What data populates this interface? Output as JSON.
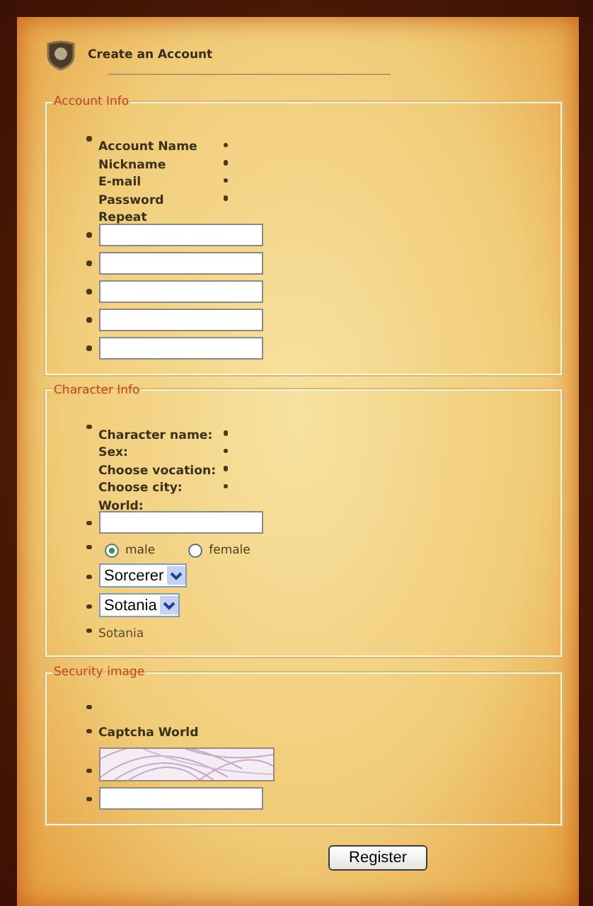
{
  "header": {
    "title": "Create an Account"
  },
  "sections": [
    {
      "legend": "Account Info",
      "labels": [
        "Account Name",
        "Nickname",
        "E-mail",
        "Password",
        "Repeat"
      ],
      "rows": [
        {
          "kind": "field"
        },
        {
          "kind": "field"
        },
        {
          "kind": "field"
        },
        {
          "kind": "field"
        },
        {
          "kind": "field"
        }
      ]
    },
    {
      "legend": "Character Info",
      "labels": [
        "Character name:",
        "Sex:",
        "Choose vocation:",
        "Choose city:",
        "World:"
      ],
      "rows": [
        {
          "kind": "field"
        },
        {
          "kind": "radio",
          "options": [
            {
              "label": "male",
              "selected": true
            },
            {
              "label": "female",
              "selected": false
            }
          ]
        },
        {
          "kind": "select",
          "value": "Sorcerer"
        },
        {
          "kind": "select",
          "value": "Sotania"
        },
        {
          "kind": "text",
          "text": "Sotania"
        }
      ]
    },
    {
      "legend": "Security image",
      "rows": [
        {
          "kind": "blank"
        },
        {
          "kind": "label",
          "text": "Captcha World"
        },
        {
          "kind": "picture"
        },
        {
          "kind": "field"
        }
      ]
    }
  ],
  "submit": "Register"
}
